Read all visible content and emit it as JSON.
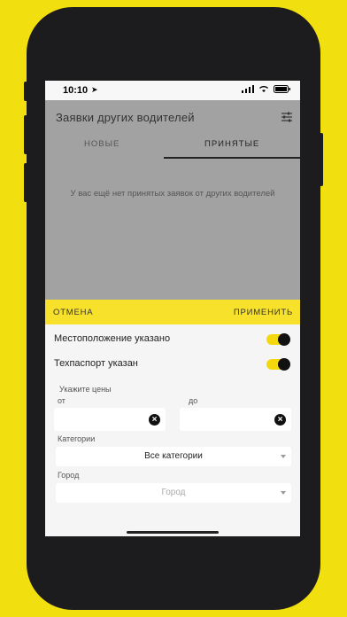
{
  "status_bar": {
    "time": "10:10"
  },
  "header": {
    "title": "Заявки других водителей"
  },
  "tabs": [
    {
      "label": "НОВЫЕ"
    },
    {
      "label": "ПРИНЯТЫЕ"
    }
  ],
  "empty_message": "У вас ещё нет принятых заявок от других водителей",
  "actions": {
    "cancel": "ОТМЕНА",
    "apply": "ПРИМЕНИТЬ"
  },
  "filters": {
    "location_label": "Местоположение указано",
    "location_on": true,
    "passport_label": "Техпаспорт указан",
    "passport_on": true,
    "price_label": "Укажите цены",
    "price_from_label": "от",
    "price_to_label": "до",
    "category_label": "Категории",
    "category_value": "Все категории",
    "city_label": "Город",
    "city_placeholder": "Город"
  },
  "colors": {
    "accent": "#f2df10",
    "overlay": "#a2a2a2"
  }
}
